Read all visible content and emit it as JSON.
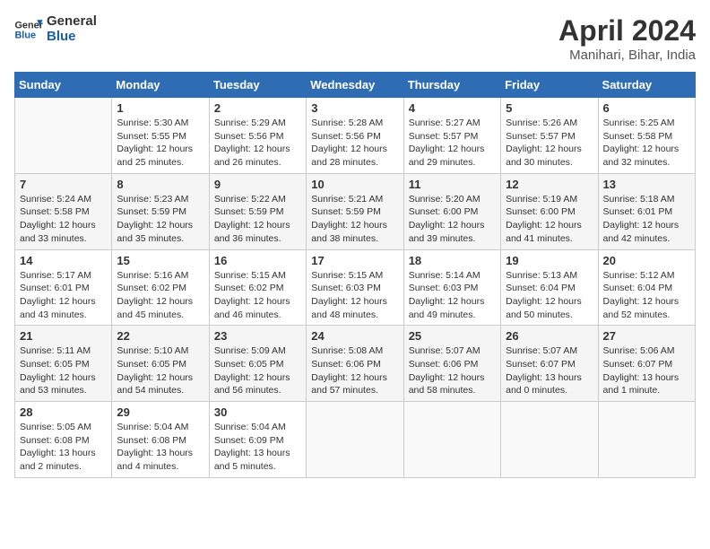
{
  "header": {
    "logo_line1": "General",
    "logo_line2": "Blue",
    "month_title": "April 2024",
    "subtitle": "Manihari, Bihar, India"
  },
  "weekdays": [
    "Sunday",
    "Monday",
    "Tuesday",
    "Wednesday",
    "Thursday",
    "Friday",
    "Saturday"
  ],
  "weeks": [
    [
      {
        "day": "",
        "info": ""
      },
      {
        "day": "1",
        "info": "Sunrise: 5:30 AM\nSunset: 5:55 PM\nDaylight: 12 hours\nand 25 minutes."
      },
      {
        "day": "2",
        "info": "Sunrise: 5:29 AM\nSunset: 5:56 PM\nDaylight: 12 hours\nand 26 minutes."
      },
      {
        "day": "3",
        "info": "Sunrise: 5:28 AM\nSunset: 5:56 PM\nDaylight: 12 hours\nand 28 minutes."
      },
      {
        "day": "4",
        "info": "Sunrise: 5:27 AM\nSunset: 5:57 PM\nDaylight: 12 hours\nand 29 minutes."
      },
      {
        "day": "5",
        "info": "Sunrise: 5:26 AM\nSunset: 5:57 PM\nDaylight: 12 hours\nand 30 minutes."
      },
      {
        "day": "6",
        "info": "Sunrise: 5:25 AM\nSunset: 5:58 PM\nDaylight: 12 hours\nand 32 minutes."
      }
    ],
    [
      {
        "day": "7",
        "info": "Sunrise: 5:24 AM\nSunset: 5:58 PM\nDaylight: 12 hours\nand 33 minutes."
      },
      {
        "day": "8",
        "info": "Sunrise: 5:23 AM\nSunset: 5:59 PM\nDaylight: 12 hours\nand 35 minutes."
      },
      {
        "day": "9",
        "info": "Sunrise: 5:22 AM\nSunset: 5:59 PM\nDaylight: 12 hours\nand 36 minutes."
      },
      {
        "day": "10",
        "info": "Sunrise: 5:21 AM\nSunset: 5:59 PM\nDaylight: 12 hours\nand 38 minutes."
      },
      {
        "day": "11",
        "info": "Sunrise: 5:20 AM\nSunset: 6:00 PM\nDaylight: 12 hours\nand 39 minutes."
      },
      {
        "day": "12",
        "info": "Sunrise: 5:19 AM\nSunset: 6:00 PM\nDaylight: 12 hours\nand 41 minutes."
      },
      {
        "day": "13",
        "info": "Sunrise: 5:18 AM\nSunset: 6:01 PM\nDaylight: 12 hours\nand 42 minutes."
      }
    ],
    [
      {
        "day": "14",
        "info": "Sunrise: 5:17 AM\nSunset: 6:01 PM\nDaylight: 12 hours\nand 43 minutes."
      },
      {
        "day": "15",
        "info": "Sunrise: 5:16 AM\nSunset: 6:02 PM\nDaylight: 12 hours\nand 45 minutes."
      },
      {
        "day": "16",
        "info": "Sunrise: 5:15 AM\nSunset: 6:02 PM\nDaylight: 12 hours\nand 46 minutes."
      },
      {
        "day": "17",
        "info": "Sunrise: 5:15 AM\nSunset: 6:03 PM\nDaylight: 12 hours\nand 48 minutes."
      },
      {
        "day": "18",
        "info": "Sunrise: 5:14 AM\nSunset: 6:03 PM\nDaylight: 12 hours\nand 49 minutes."
      },
      {
        "day": "19",
        "info": "Sunrise: 5:13 AM\nSunset: 6:04 PM\nDaylight: 12 hours\nand 50 minutes."
      },
      {
        "day": "20",
        "info": "Sunrise: 5:12 AM\nSunset: 6:04 PM\nDaylight: 12 hours\nand 52 minutes."
      }
    ],
    [
      {
        "day": "21",
        "info": "Sunrise: 5:11 AM\nSunset: 6:05 PM\nDaylight: 12 hours\nand 53 minutes."
      },
      {
        "day": "22",
        "info": "Sunrise: 5:10 AM\nSunset: 6:05 PM\nDaylight: 12 hours\nand 54 minutes."
      },
      {
        "day": "23",
        "info": "Sunrise: 5:09 AM\nSunset: 6:05 PM\nDaylight: 12 hours\nand 56 minutes."
      },
      {
        "day": "24",
        "info": "Sunrise: 5:08 AM\nSunset: 6:06 PM\nDaylight: 12 hours\nand 57 minutes."
      },
      {
        "day": "25",
        "info": "Sunrise: 5:07 AM\nSunset: 6:06 PM\nDaylight: 12 hours\nand 58 minutes."
      },
      {
        "day": "26",
        "info": "Sunrise: 5:07 AM\nSunset: 6:07 PM\nDaylight: 13 hours\nand 0 minutes."
      },
      {
        "day": "27",
        "info": "Sunrise: 5:06 AM\nSunset: 6:07 PM\nDaylight: 13 hours\nand 1 minute."
      }
    ],
    [
      {
        "day": "28",
        "info": "Sunrise: 5:05 AM\nSunset: 6:08 PM\nDaylight: 13 hours\nand 2 minutes."
      },
      {
        "day": "29",
        "info": "Sunrise: 5:04 AM\nSunset: 6:08 PM\nDaylight: 13 hours\nand 4 minutes."
      },
      {
        "day": "30",
        "info": "Sunrise: 5:04 AM\nSunset: 6:09 PM\nDaylight: 13 hours\nand 5 minutes."
      },
      {
        "day": "",
        "info": ""
      },
      {
        "day": "",
        "info": ""
      },
      {
        "day": "",
        "info": ""
      },
      {
        "day": "",
        "info": ""
      }
    ]
  ]
}
